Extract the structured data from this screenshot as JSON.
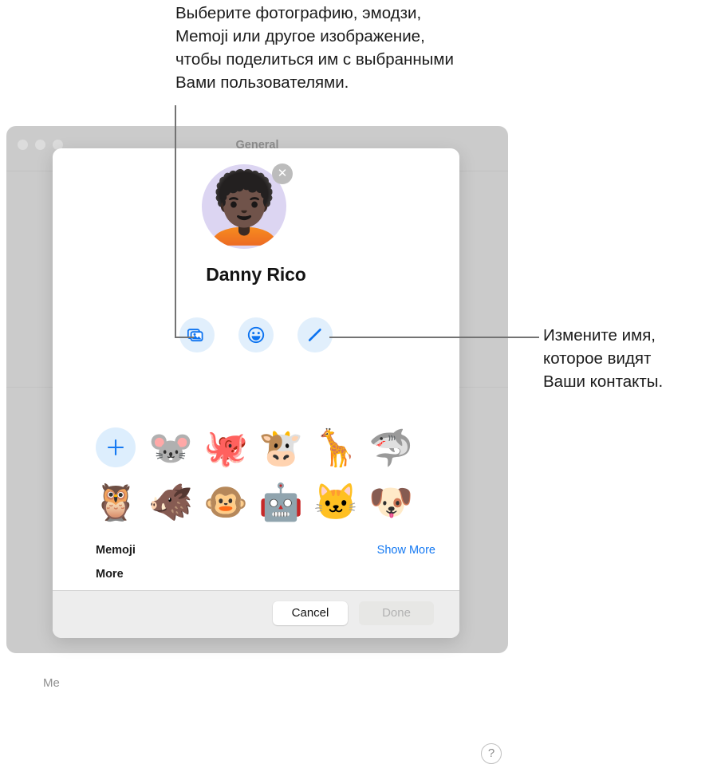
{
  "callouts": {
    "top": "Выберите фотографию, эмодзи,\nMemoji или другое изображение,\nчтобы поделиться им с выбранными\nВами пользователями.",
    "right": "Измените имя,\nкоторое видят\nВаши контакты."
  },
  "background_window": {
    "title": "General",
    "partial_label": "Me",
    "help_label": "?",
    "traffic_lights": [
      "close",
      "minimize",
      "maximize"
    ]
  },
  "sheet": {
    "avatar": {
      "memoji_glyph": "🧑🏿‍🦱",
      "close_label": "✕",
      "background_color": "#dcd5f2"
    },
    "profile_name": "Danny Rico",
    "actions": [
      {
        "name": "photos",
        "icon": "photos-icon"
      },
      {
        "name": "emoji",
        "icon": "smiley-icon"
      },
      {
        "name": "edit-name",
        "icon": "pencil-icon"
      }
    ],
    "sections": {
      "memoji_header": "Memoji",
      "show_more": "Show More",
      "more_header": "More"
    },
    "memoji_grid": {
      "add_label": "+",
      "rows": [
        [
          {
            "type": "add",
            "glyph": "+",
            "name": "new-memoji"
          },
          {
            "type": "emoji",
            "glyph": "🐭",
            "name": "mouse"
          },
          {
            "type": "emoji",
            "glyph": "🐙",
            "name": "octopus"
          },
          {
            "type": "emoji",
            "glyph": "🐮",
            "name": "cow"
          },
          {
            "type": "emoji",
            "glyph": "🦒",
            "name": "giraffe"
          },
          {
            "type": "emoji",
            "glyph": "🦈",
            "name": "shark"
          }
        ],
        [
          {
            "type": "emoji",
            "glyph": "🦉",
            "name": "owl"
          },
          {
            "type": "emoji",
            "glyph": "🐗",
            "name": "boar"
          },
          {
            "type": "emoji",
            "glyph": "🐵",
            "name": "monkey"
          },
          {
            "type": "emoji",
            "glyph": "🤖",
            "name": "robot"
          },
          {
            "type": "emoji",
            "glyph": "🐱",
            "name": "cat"
          },
          {
            "type": "emoji",
            "glyph": "🐶",
            "name": "dog"
          }
        ]
      ]
    },
    "footer": {
      "cancel_label": "Cancel",
      "done_label": "Done",
      "done_enabled": false
    }
  },
  "colors": {
    "accent_blue": "#1579f2",
    "action_bg": "#e1effc",
    "window_grey": "#cbcbcb",
    "footer_grey": "#ededed"
  }
}
